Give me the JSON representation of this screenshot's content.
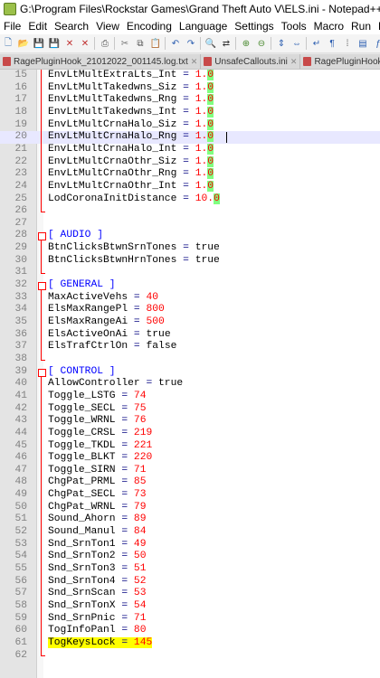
{
  "window": {
    "title": "G:\\Program Files\\Rockstar Games\\Grand Theft Auto V\\ELS.ini - Notepad++"
  },
  "menu": [
    "File",
    "Edit",
    "Search",
    "View",
    "Encoding",
    "Language",
    "Settings",
    "Tools",
    "Macro",
    "Run",
    "Plugins",
    "Wi"
  ],
  "toolbar_icons": [
    "new-file-icon",
    "open-file-icon",
    "save-icon",
    "save-all-icon",
    "close-icon",
    "close-all-icon",
    "print-icon",
    "cut-icon",
    "copy-icon",
    "paste-icon",
    "undo-icon",
    "redo-icon",
    "find-icon",
    "replace-icon",
    "zoom-in-icon",
    "zoom-out-icon",
    "sync-v-icon",
    "sync-h-icon",
    "wrap-icon",
    "all-chars-icon",
    "indent-guide-icon",
    "doc-map-icon",
    "function-list-icon"
  ],
  "tabs": [
    {
      "label": "RagePluginHook_21012022_001145.log.txt",
      "active": false
    },
    {
      "label": "UnsafeCallouts.ini",
      "active": false
    },
    {
      "label": "RagePluginHook.log-5.txt",
      "active": false
    },
    {
      "label": "Rag",
      "active": false
    }
  ],
  "lines": [
    {
      "n": "15",
      "key": "EnvLtMultExtraLts_Int",
      "val": "1.0"
    },
    {
      "n": "16",
      "key": "EnvLtMultTakedwns_Siz",
      "val": "1.0"
    },
    {
      "n": "17",
      "key": "EnvLtMultTakedwns_Rng",
      "val": "1.0"
    },
    {
      "n": "18",
      "key": "EnvLtMultTakedwns_Int",
      "val": "1.0"
    },
    {
      "n": "19",
      "key": "EnvLtMultCrnaHalo_Siz",
      "val": "1.0"
    },
    {
      "n": "20",
      "key": "EnvLtMultCrnaHalo_Rng",
      "val": "1.0",
      "current": true
    },
    {
      "n": "21",
      "key": "EnvLtMultCrnaHalo_Int",
      "val": "1.0"
    },
    {
      "n": "22",
      "key": "EnvLtMultCrnaOthr_Siz",
      "val": "1.0"
    },
    {
      "n": "23",
      "key": "EnvLtMultCrnaOthr_Rng",
      "val": "1.0"
    },
    {
      "n": "24",
      "key": "EnvLtMultCrnaOthr_Int",
      "val": "1.0"
    },
    {
      "n": "25",
      "key": "LodCoronaInitDistance",
      "val": "10.0"
    },
    {
      "n": "26"
    },
    {
      "n": "27"
    },
    {
      "n": "28",
      "section": "[ AUDIO ]"
    },
    {
      "n": "29",
      "key": "BtnClicksBtwnSrnTones",
      "val": "true"
    },
    {
      "n": "30",
      "key": "BtnClicksBtwnHrnTones",
      "val": "true"
    },
    {
      "n": "31"
    },
    {
      "n": "32",
      "section": "[ GENERAL ]"
    },
    {
      "n": "33",
      "key": "MaxActiveVehs",
      "val": "40"
    },
    {
      "n": "34",
      "key": "ElsMaxRangePl",
      "val": "800"
    },
    {
      "n": "35",
      "key": "ElsMaxRangeAi",
      "val": "500"
    },
    {
      "n": "36",
      "key": "ElsActiveOnAi",
      "val": "true"
    },
    {
      "n": "37",
      "key": "ElsTrafCtrlOn",
      "val": "false"
    },
    {
      "n": "38"
    },
    {
      "n": "39",
      "section": "[ CONTROL ]"
    },
    {
      "n": "40",
      "key": "AllowController",
      "val": "true"
    },
    {
      "n": "41",
      "key": "Toggle_LSTG",
      "val": "74"
    },
    {
      "n": "42",
      "key": "Toggle_SECL",
      "val": "75"
    },
    {
      "n": "43",
      "key": "Toggle_WRNL",
      "val": "76"
    },
    {
      "n": "44",
      "key": "Toggle_CRSL",
      "val": "219"
    },
    {
      "n": "45",
      "key": "Toggle_TKDL",
      "val": "221"
    },
    {
      "n": "46",
      "key": "Toggle_BLKT",
      "val": "220"
    },
    {
      "n": "47",
      "key": "Toggle_SIRN",
      "val": "71"
    },
    {
      "n": "48",
      "key": "ChgPat_PRML",
      "val": "85"
    },
    {
      "n": "49",
      "key": "ChgPat_SECL",
      "val": "73"
    },
    {
      "n": "50",
      "key": "ChgPat_WRNL",
      "val": "79"
    },
    {
      "n": "51",
      "key": "Sound_Ahorn",
      "val": "89"
    },
    {
      "n": "52",
      "key": "Sound_Manul",
      "val": "84"
    },
    {
      "n": "53",
      "key": "Snd_SrnTon1",
      "val": "49"
    },
    {
      "n": "54",
      "key": "Snd_SrnTon2",
      "val": "50"
    },
    {
      "n": "55",
      "key": "Snd_SrnTon3",
      "val": "51"
    },
    {
      "n": "56",
      "key": "Snd_SrnTon4",
      "val": "52"
    },
    {
      "n": "57",
      "key": "Snd_SrnScan",
      "val": "53"
    },
    {
      "n": "58",
      "key": "Snd_SrnTonX",
      "val": "54"
    },
    {
      "n": "59",
      "key": "Snd_SrnPnic",
      "val": "71"
    },
    {
      "n": "60",
      "key": "TogInfoPanl",
      "val": "80"
    },
    {
      "n": "61",
      "key": "TogKeysLock",
      "val": "145",
      "highlight": true
    },
    {
      "n": "62"
    }
  ]
}
